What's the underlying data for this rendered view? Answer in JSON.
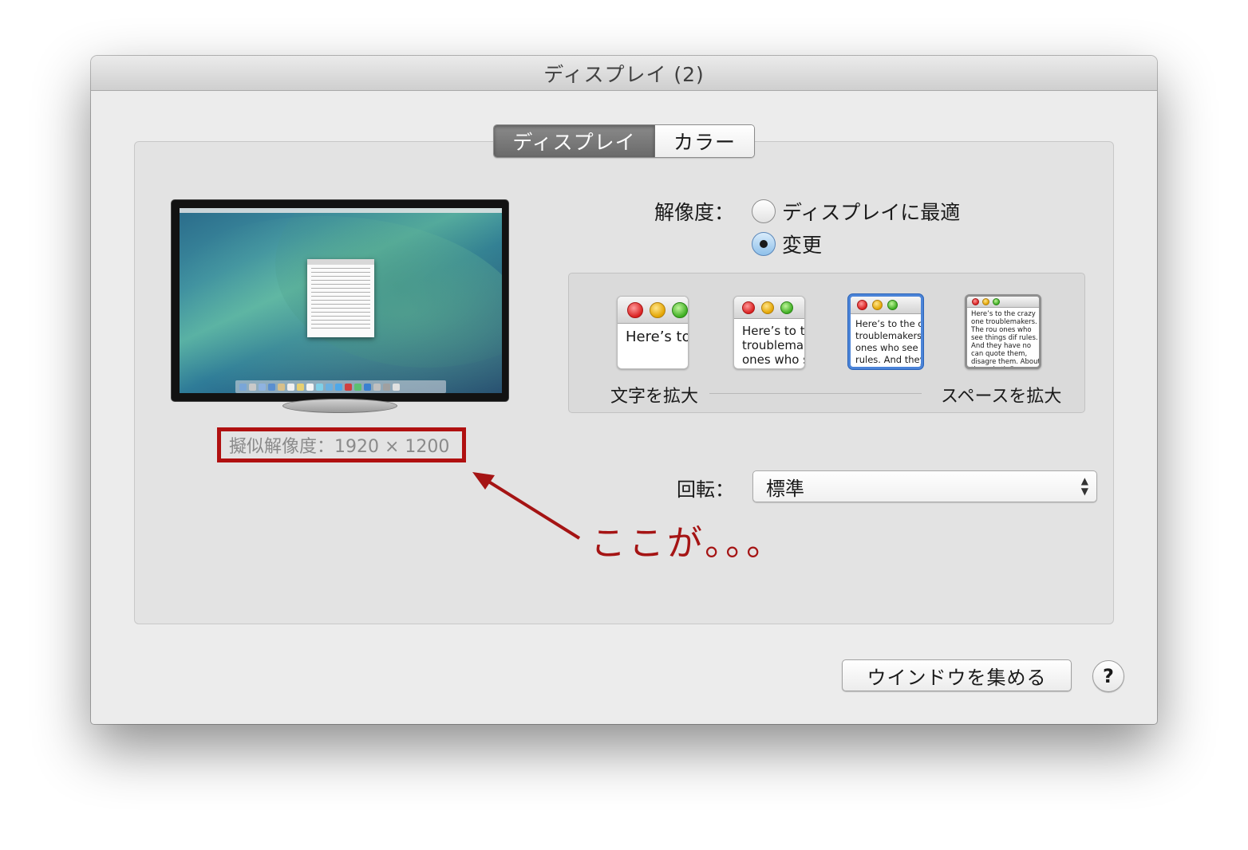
{
  "window": {
    "title": "ディスプレイ (2)"
  },
  "tabs": [
    {
      "label": "ディスプレイ",
      "active": true
    },
    {
      "label": "カラー",
      "active": false
    }
  ],
  "monitor": {
    "resolution_label": "擬似解像度：1920 × 1200"
  },
  "annotation": {
    "text": "ここが。。。",
    "color": "#a51414"
  },
  "resolution": {
    "title": "解像度：",
    "options": [
      {
        "label": "ディスプレイに最適",
        "selected": false
      },
      {
        "label": "変更",
        "selected": true
      }
    ]
  },
  "scaling": {
    "options": [
      {
        "text": "Here’s to troublem",
        "selected": false
      },
      {
        "text": "Here’s to th troublemak ones who s",
        "selected": false
      },
      {
        "text": "Here’s to the cr troublemakers. ones who see t rules. And they",
        "selected": true
      },
      {
        "text": "Here’s to the crazy one troublemakers. The rou ones who see things dif rules. And they have no can quote them, disagre them. About the only th Because they change th",
        "selected": false
      }
    ],
    "left_caption": "文字を拡大",
    "right_caption": "スペースを拡大"
  },
  "rotation": {
    "label": "回転：",
    "value": "標準"
  },
  "buttons": {
    "gather_windows": "ウインドウを集める",
    "help": "?"
  },
  "colors": {
    "accent": "#4b84d8",
    "highlight_box": "#b01010"
  }
}
